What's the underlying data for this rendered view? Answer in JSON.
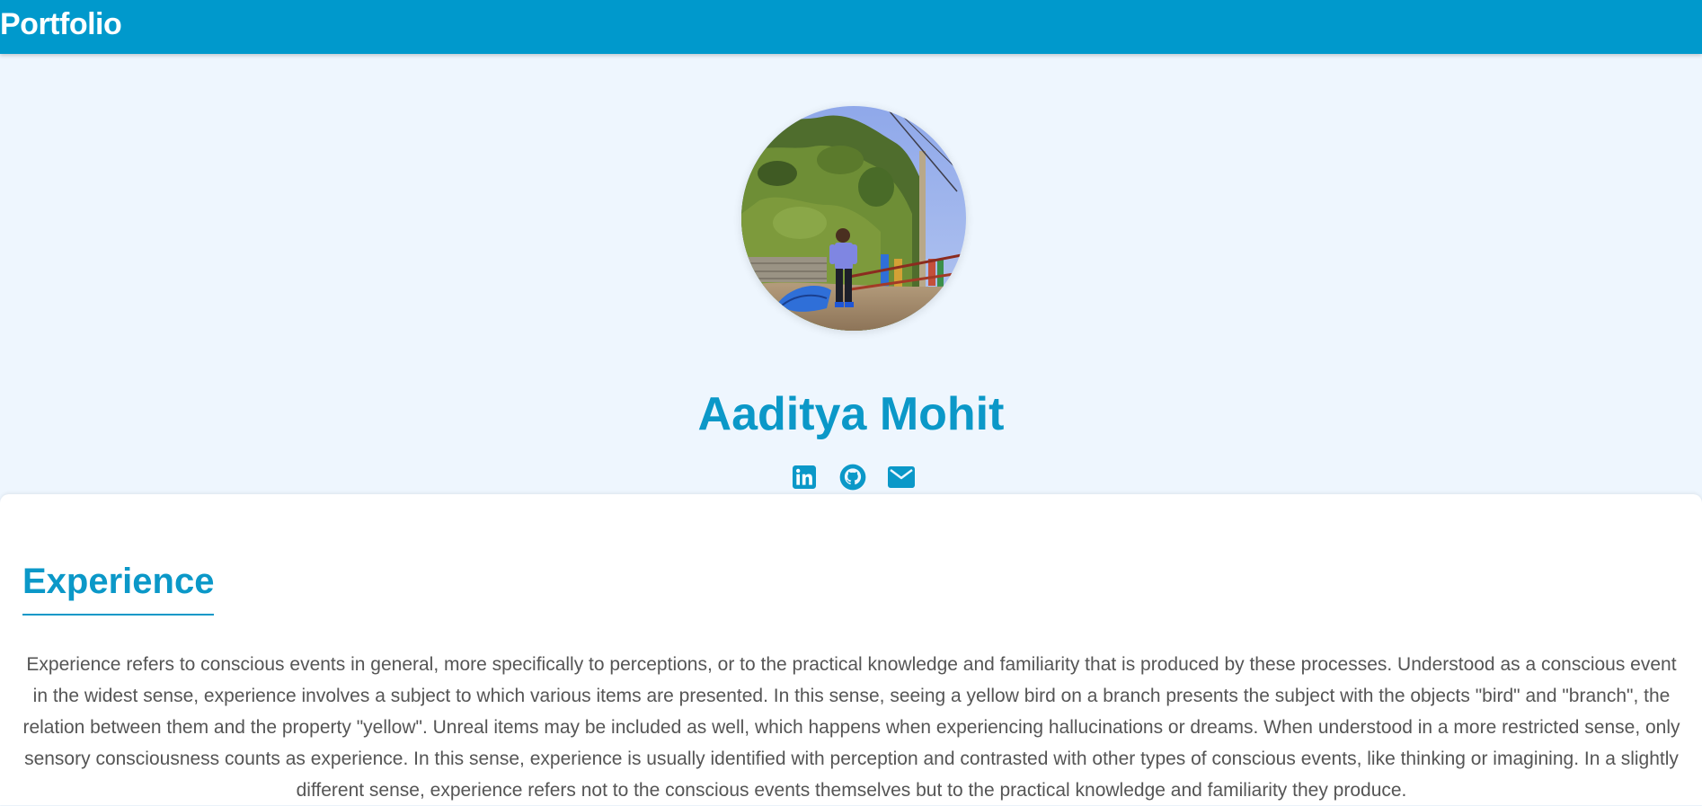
{
  "header": {
    "brand": "Portfolio",
    "background_color": "#0099cc"
  },
  "profile": {
    "name": "Aaditya Mohit",
    "photo_alt": "profile photo",
    "accent_color": "#0b98c8",
    "social_links": [
      {
        "icon": "linkedin-icon"
      },
      {
        "icon": "github-icon"
      },
      {
        "icon": "envelope-icon"
      }
    ]
  },
  "experience": {
    "title": "Experience",
    "text": "Experience refers to conscious events in general, more specifically to perceptions, or to the practical knowledge and familiarity that is produced by these processes. Understood as a conscious event in the widest sense, experience involves a subject to which various items are presented. In this sense, seeing a yellow bird on a branch presents the subject with the objects \"bird\" and \"branch\", the relation between them and the property \"yellow\". Unreal items may be included as well, which happens when experiencing hallucinations or dreams. When understood in a more restricted sense, only sensory consciousness counts as experience. In this sense, experience is usually identified with perception and contrasted with other types of conscious events, like thinking or imagining. In a slightly different sense, experience refers not to the conscious events themselves but to the practical knowledge and familiarity they produce."
  }
}
